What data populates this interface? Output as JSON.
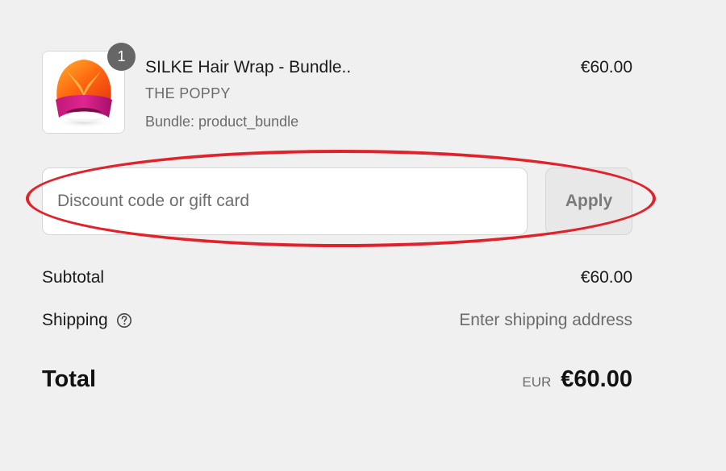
{
  "product": {
    "quantity": "1",
    "name": "SILKE Hair Wrap - Bundle..",
    "vendor": "THE POPPY",
    "variant": "Bundle: product_bundle",
    "price": "€60.00",
    "image_icon": "hair-wrap-image"
  },
  "discount": {
    "placeholder": "Discount code or gift card",
    "value": "",
    "apply_label": "Apply",
    "highlight_color": "#e0232b"
  },
  "summary": {
    "subtotal_label": "Subtotal",
    "subtotal_value": "€60.00",
    "shipping_label": "Shipping",
    "shipping_icon": "question-circle-icon",
    "shipping_value": "Enter shipping address",
    "total_label": "Total",
    "currency_code": "EUR",
    "total_value": "€60.00"
  },
  "colors": {
    "background": "#f0f0f0",
    "badge": "#666666",
    "highlight": "#e0232b"
  }
}
